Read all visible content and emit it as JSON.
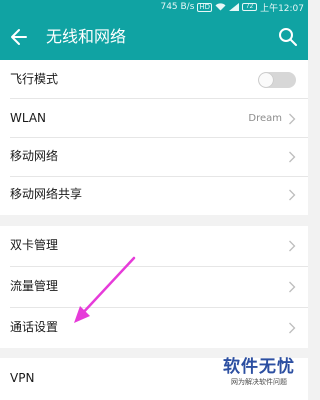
{
  "status_bar": {
    "speed": "745 B/s",
    "hd": "HD",
    "battery": "72",
    "time": "上午12:07"
  },
  "app_bar": {
    "title": "无线和网络",
    "back_icon": "arrow-left-icon",
    "search_icon": "search-icon"
  },
  "settings": {
    "airplane_mode": {
      "label": "飞行模式",
      "enabled": false
    },
    "wlan": {
      "label": "WLAN",
      "value": "Dream"
    },
    "mobile_network": {
      "label": "移动网络"
    },
    "tethering": {
      "label": "移动网络共享"
    },
    "dual_sim": {
      "label": "双卡管理"
    },
    "data_usage": {
      "label": "流量管理"
    },
    "call_settings": {
      "label": "通话设置"
    },
    "vpn": {
      "label": "VPN"
    }
  },
  "watermark": {
    "title": "软件无忧",
    "subtitle": "网为解决软件问题"
  },
  "colors": {
    "accent": "#10a3a3",
    "annotation_arrow": "#e63bd9",
    "watermark_title": "#2c4fa1"
  }
}
